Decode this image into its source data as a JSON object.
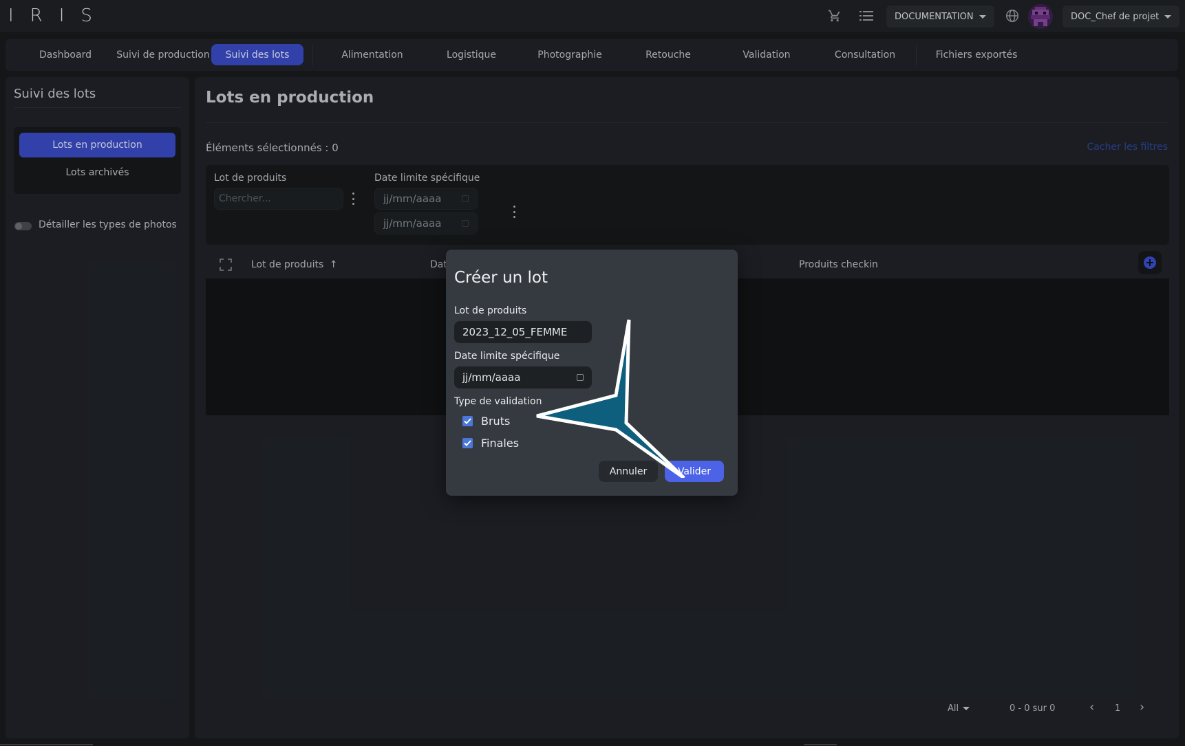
{
  "app": {
    "logo": [
      "I",
      "R",
      "I",
      "S"
    ]
  },
  "topbar": {
    "documentation": "DOCUMENTATION",
    "user": "DOC_Chef de projet",
    "icons": [
      "cart-icon",
      "list-icon",
      "globe-icon"
    ]
  },
  "nav": {
    "tabs": [
      {
        "label": "Dashboard"
      },
      {
        "label": "Suivi de production"
      },
      {
        "label": "Suivi des lots",
        "active": true
      },
      {
        "label": "Alimentation"
      },
      {
        "label": "Logistique"
      },
      {
        "label": "Photographie"
      },
      {
        "label": "Retouche"
      },
      {
        "label": "Validation"
      },
      {
        "label": "Consultation"
      },
      {
        "label": "Fichiers exportés"
      }
    ]
  },
  "sidebar": {
    "title": "Suivi des lots",
    "items": [
      {
        "label": "Lots en production",
        "active": true
      },
      {
        "label": "Lots archivés"
      }
    ],
    "toggle_label": "Détailler les types de photos"
  },
  "main": {
    "title": "Lots en production",
    "selected": "Éléments sélectionnés : 0",
    "hide_filters": "Cacher les filtres",
    "filters": {
      "lot_label": "Lot de produits",
      "search_placeholder": "Chercher...",
      "date_label": "Date limite spécifique",
      "date_from": "jj/mm/aaaa",
      "date_to": "jj/mm/aaaa"
    },
    "table": {
      "columns": [
        "Lot de produits",
        "Dat",
        "Produits checkin"
      ]
    },
    "pager": {
      "per_page": "All",
      "range": "0 - 0 sur 0",
      "page": "1"
    }
  },
  "modal": {
    "title": "Créer un lot",
    "lot_label": "Lot de produits",
    "lot_value": "2023_12_05_FEMME",
    "date_label": "Date limite spécifique",
    "date_value": "jj/mm/aaaa",
    "validation_label": "Type de validation",
    "checks": [
      {
        "label": "Bruts",
        "checked": true
      },
      {
        "label": "Finales",
        "checked": true
      }
    ],
    "cancel": "Annuler",
    "confirm": "Valider"
  },
  "colors": {
    "accent": "#3b4dc8",
    "confirm": "#4c63e8",
    "pointer": "#0e5f7e"
  }
}
